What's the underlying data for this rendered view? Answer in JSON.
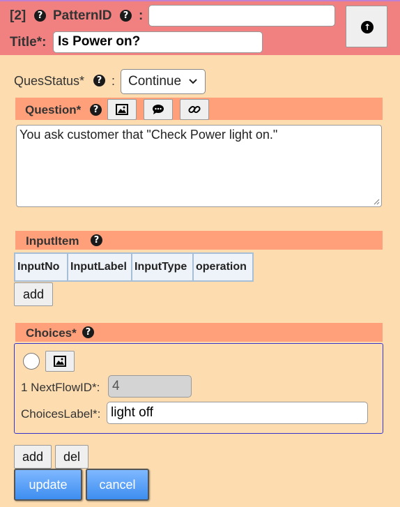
{
  "header": {
    "index": "[2]",
    "pattern_label": "PatternID",
    "colon": ":",
    "pattern_value": "",
    "title_label": "Title*:",
    "title_value": "Is Power on?"
  },
  "status": {
    "label": "QuesStatus*",
    "colon": ":",
    "selected": "Continue"
  },
  "question": {
    "title": "Question*",
    "text": "You ask customer that \"Check Power light on.\""
  },
  "input_item": {
    "title": "InputItem",
    "columns": [
      "InputNo",
      "InputLabel",
      "InputType",
      "operation"
    ],
    "add_label": "add"
  },
  "choices": {
    "title": "Choices*",
    "next_flow_label": "1 NextFlowID*:",
    "next_flow_value": "4",
    "choices_label": "ChoicesLabel*:",
    "choices_value": "light off",
    "add_label": "add",
    "del_label": "del"
  },
  "footer": {
    "update_label": "update",
    "cancel_label": "cancel"
  },
  "icons": {
    "help": "question-circle-icon",
    "upload": "arrow-up-circle-icon",
    "image": "image-icon",
    "comment": "comment-icon",
    "link": "link-icon"
  },
  "colors": {
    "header_bg": "#f18080",
    "page_bg": "#fdddb0",
    "section_bar": "#ffa07a",
    "primary_button": "#4d96f4"
  }
}
